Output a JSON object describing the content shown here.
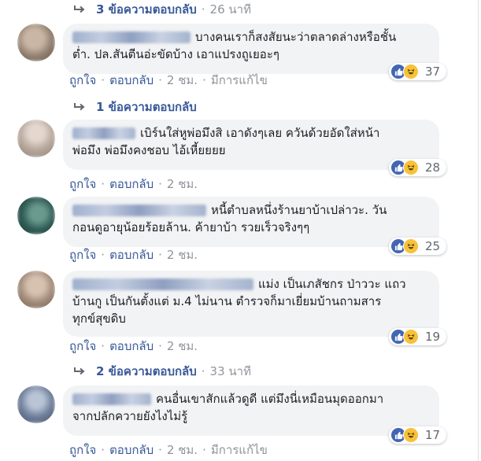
{
  "reply_summaries": [
    {
      "count": "3 ข้อความตอบกลับ",
      "time": "26 นาที"
    },
    {
      "count": "1 ข้อความตอบกลับ",
      "time": ""
    },
    {
      "count": "2 ข้อความตอบกลับ",
      "time": "33 นาที"
    }
  ],
  "separator": "·",
  "comments": [
    {
      "line1": "บางคนเราก็สงสัยนะว่าตลาดล่างหรือชั้น",
      "line2": "ต่ำ. ปล.สันตีนอ่ะขัดบ้าง เอาแปรงถูเยอะๆ",
      "line3": "",
      "reactions": "37",
      "like": "ถูกใจ",
      "reply": "ตอบกลับ",
      "time": "2 ชม.",
      "edited": "มีการแก้ไข"
    },
    {
      "line1": "เบิร์นใส่หูพ่อมึงสิ เอาดังๆเลย ควันด้วยอัดใส่หน้า",
      "line2": "พ่อมึง พ่อมึงคงชอบ ไอ้เหี้ยยยย",
      "line3": "",
      "reactions": "28",
      "like": "ถูกใจ",
      "reply": "ตอบกลับ",
      "time": "2 ชม.",
      "edited": ""
    },
    {
      "line1": "หนี้ตำบลหนึ่งร้านยาบ้าเปล่าวะ. วัน",
      "line2": "กอนดูอายุน้อยร้อยล้าน. ค้ายาบ้า รวยเร็วจริงๆๆ",
      "line3": "",
      "reactions": "25",
      "like": "ถูกใจ",
      "reply": "ตอบกลับ",
      "time": "2 ชม.",
      "edited": ""
    },
    {
      "line1": "แม่ง เป็นเภสัชกร ป่าววะ แถว",
      "line2": "บ้านกู เป็นกันตั้งแต่ ม.4 ไม่นาน ตำรวจก็มาเยี่ยมบ้านถามสาร",
      "line3": "ทุกข์สุขดิบ",
      "reactions": "19",
      "like": "ถูกใจ",
      "reply": "ตอบกลับ",
      "time": "2 ชม.",
      "edited": ""
    },
    {
      "line1": "คนอื่นเขาสักแล้วดูดี แต่มึงนี่เหมือนมุดออกมา",
      "line2": "จากปลักควายยังไงไม่รู้",
      "line3": "",
      "reactions": "17",
      "like": "ถูกใจ",
      "reply": "ตอบกลับ",
      "time": "2 ชม.",
      "edited": "มีการแก้ไข"
    }
  ]
}
